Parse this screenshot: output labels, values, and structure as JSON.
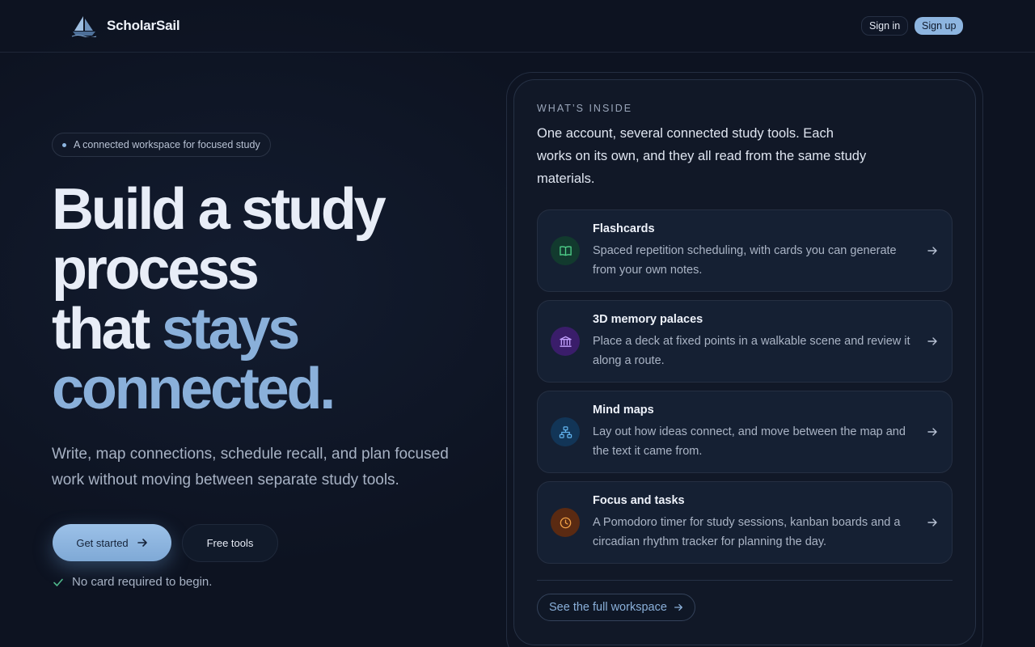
{
  "header": {
    "brand_name": "ScholarSail",
    "signin_label": "Sign in",
    "signup_label": "Sign up"
  },
  "hero": {
    "pill_text": "A connected workspace for focused study",
    "headline_line1": "Build a study",
    "headline_line2": "process",
    "headline_line3_plain": "that ",
    "headline_line3_accent": "stays",
    "headline_line4_accent": "connected.",
    "subtitle": "Write, map connections, schedule recall, and plan focused work without moving between separate study tools.",
    "primary_button": "Get started",
    "secondary_button": "Free tools",
    "note": "No card required to begin."
  },
  "panel": {
    "kicker": "WHAT’S INSIDE",
    "intro": "One account, several connected study tools. Each works on its own, and they all read from the same study materials.",
    "features": [
      {
        "title": "Flashcards",
        "desc": "Spaced repetition scheduling, with cards you can generate from your own notes.",
        "icon": "book-icon",
        "color": "#4fd08a"
      },
      {
        "title": "3D memory palaces",
        "desc": "Place a deck at fixed points in a walkable scene and review it along a route.",
        "icon": "landmark-icon",
        "color": "#b48cf5"
      },
      {
        "title": "Mind maps",
        "desc": "Lay out how ideas connect, and move between the map and the text it came from.",
        "icon": "network-icon",
        "color": "#62b3ee"
      },
      {
        "title": "Focus and tasks",
        "desc": "A Pomodoro timer for study sessions, kanban boards and a circadian rhythm tracker for planning the day.",
        "icon": "clock-icon",
        "color": "#f0a046"
      }
    ],
    "see_all": "See the full workspace"
  },
  "colors": {
    "accent": "#8ab0da",
    "background": "#0d1321"
  }
}
